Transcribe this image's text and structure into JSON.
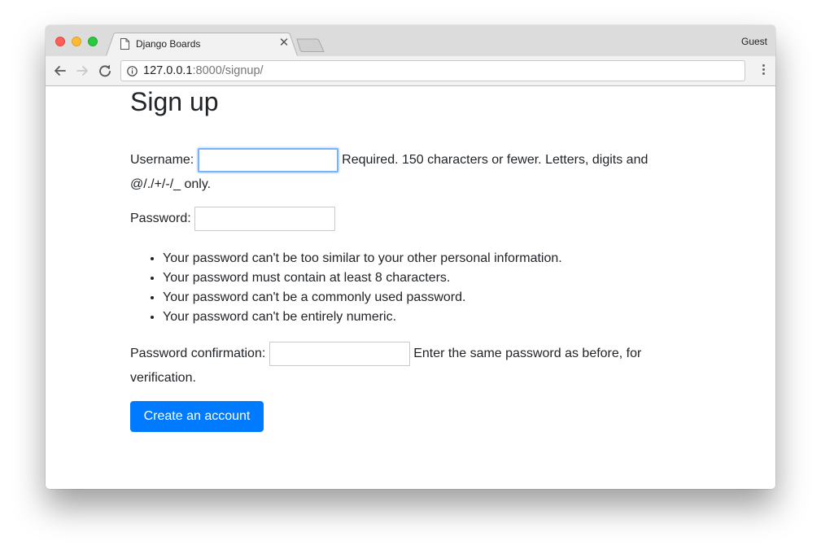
{
  "browser": {
    "tab_title": "Django Boards",
    "profile_label": "Guest",
    "url_host": "127.0.0.1",
    "url_rest": ":8000/signup/",
    "icons": {
      "back": "arrow-left-icon",
      "forward": "arrow-right-icon",
      "reload": "reload-icon",
      "info": "info-icon",
      "menu": "vertical-dots-icon",
      "tab_page": "document-icon",
      "tab_close": "close-icon"
    },
    "colors": {
      "close": "#fc5f57",
      "minimize": "#fdbc2e",
      "maximize": "#28c840"
    }
  },
  "page": {
    "title": "Sign up",
    "username": {
      "label": "Username:",
      "value": "",
      "help_line1": "Required. 150 characters or fewer. Letters, digits and",
      "help_line2": "@/./+/-/_ only."
    },
    "password": {
      "label": "Password:",
      "value": "",
      "rules": [
        "Your password can't be too similar to your other personal information.",
        "Your password must contain at least 8 characters.",
        "Your password can't be a commonly used password.",
        "Your password can't be entirely numeric."
      ]
    },
    "password_confirmation": {
      "label": "Password confirmation:",
      "value": "",
      "help_line1": "Enter the same password as before, for",
      "help_line2": "verification."
    },
    "submit_label": "Create an account",
    "accent_color": "#007bff"
  }
}
